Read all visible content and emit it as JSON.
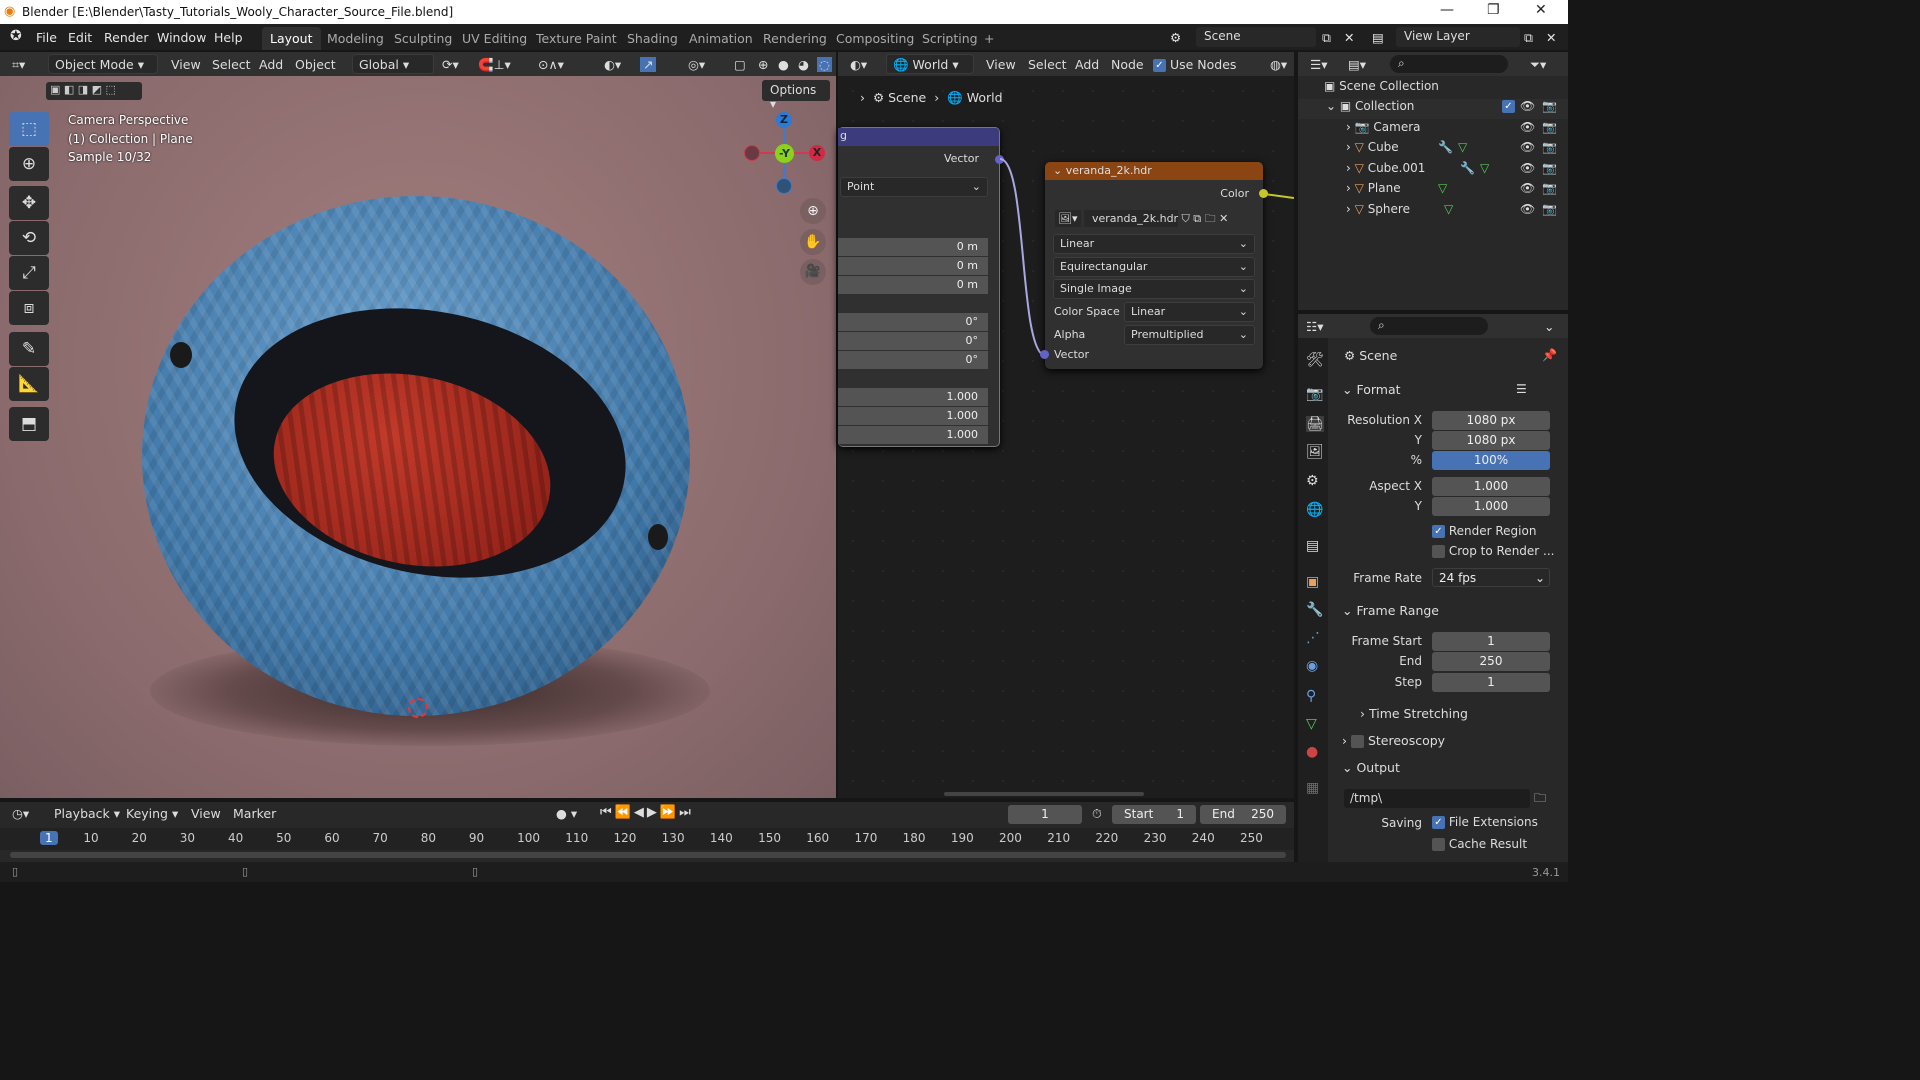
{
  "window": {
    "title": "Blender [E:\\Blender\\Tasty_Tutorials_Wooly_Character_Source_File.blend]",
    "controls": [
      "minimize",
      "maximize",
      "close"
    ]
  },
  "menu": [
    "File",
    "Edit",
    "Render",
    "Window",
    "Help"
  ],
  "workspaces": [
    "Layout",
    "Modeling",
    "Sculpting",
    "UV Editing",
    "Texture Paint",
    "Shading",
    "Animation",
    "Rendering",
    "Compositing",
    "Scripting",
    "+"
  ],
  "active_workspace": "Layout",
  "scene_name": "Scene",
  "view_layer": "View Layer",
  "viewport": {
    "mode": "Object Mode",
    "menus": [
      "View",
      "Select",
      "Add",
      "Object"
    ],
    "orientation": "Global",
    "options": "Options",
    "overlay": [
      "Camera Perspective",
      "(1) Collection | Plane",
      "Sample 10/32"
    ],
    "gizmo": {
      "z": "Z",
      "y": "-Y",
      "x": "X"
    }
  },
  "node_editor": {
    "world_dropdown": "World",
    "menus": [
      "View",
      "Select",
      "Add",
      "Node"
    ],
    "use_nodes": "Use Nodes",
    "breadcrumb": [
      "Scene",
      "World"
    ],
    "mapping_node": {
      "title": "g",
      "output": "Vector",
      "type": "Point",
      "location": [
        "0 m",
        "0 m",
        "0 m"
      ],
      "rotation": [
        "0°",
        "0°",
        "0°"
      ],
      "scale": [
        "1.000",
        "1.000",
        "1.000"
      ]
    },
    "image_node": {
      "title": "veranda_2k.hdr",
      "output": "Color",
      "image": "veranda_2k.hdr",
      "interpolation": "Linear",
      "projection": "Equirectangular",
      "source": "Single Image",
      "color_space_label": "Color Space",
      "color_space": "Linear",
      "alpha_label": "Alpha",
      "alpha": "Premultiplied",
      "input": "Vector"
    },
    "header_color": "#3b3b7e",
    "image_header_color": "#8b4513"
  },
  "outliner": {
    "root": "Scene Collection",
    "collection": "Collection",
    "items": [
      "Camera",
      "Cube",
      "Cube.001",
      "Plane",
      "Sphere"
    ]
  },
  "properties": {
    "context": "Scene",
    "format": {
      "title": "Format",
      "res_x_label": "Resolution X",
      "res_x": "1080 px",
      "res_y_label": "Y",
      "res_y": "1080 px",
      "pct_label": "%",
      "pct": "100%",
      "aspect_x_label": "Aspect X",
      "aspect_x": "1.000",
      "aspect_y_label": "Y",
      "aspect_y": "1.000",
      "render_region": "Render Region",
      "crop": "Crop to Render ...",
      "frame_rate_label": "Frame Rate",
      "frame_rate": "24 fps"
    },
    "frame_range": {
      "title": "Frame Range",
      "start_label": "Frame Start",
      "start": "1",
      "end_label": "End",
      "end": "250",
      "step_label": "Step",
      "step": "1"
    },
    "time_stretching": "Time Stretching",
    "stereoscopy": "Stereoscopy",
    "output": {
      "title": "Output",
      "path": "/tmp\\",
      "saving_label": "Saving",
      "file_ext": "File Extensions",
      "cache": "Cache Result"
    }
  },
  "timeline": {
    "menus": [
      "Playback",
      "Keying",
      "View",
      "Marker"
    ],
    "current": "1",
    "start_label": "Start",
    "start": "1",
    "end_label": "End",
    "end": "250",
    "ticks": [
      "1",
      "10",
      "20",
      "30",
      "40",
      "50",
      "60",
      "70",
      "80",
      "90",
      "100",
      "110",
      "120",
      "130",
      "140",
      "150",
      "160",
      "170",
      "180",
      "190",
      "200",
      "210",
      "220",
      "230",
      "240",
      "250"
    ]
  },
  "version": "3.4.1",
  "accent": "#4772b3"
}
